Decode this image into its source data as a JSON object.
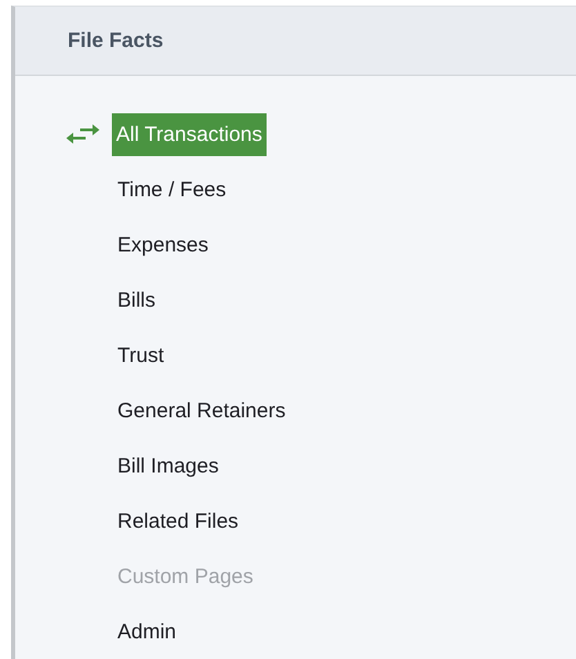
{
  "panel": {
    "title": "File Facts"
  },
  "items": [
    {
      "label": "All Transactions",
      "selected": true,
      "disabled": false
    },
    {
      "label": "Time / Fees",
      "selected": false,
      "disabled": false
    },
    {
      "label": "Expenses",
      "selected": false,
      "disabled": false
    },
    {
      "label": "Bills",
      "selected": false,
      "disabled": false
    },
    {
      "label": "Trust",
      "selected": false,
      "disabled": false
    },
    {
      "label": "General Retainers",
      "selected": false,
      "disabled": false
    },
    {
      "label": "Bill Images",
      "selected": false,
      "disabled": false
    },
    {
      "label": "Related Files",
      "selected": false,
      "disabled": false
    },
    {
      "label": "Custom Pages",
      "selected": false,
      "disabled": true
    },
    {
      "label": "Admin",
      "selected": false,
      "disabled": false
    }
  ]
}
